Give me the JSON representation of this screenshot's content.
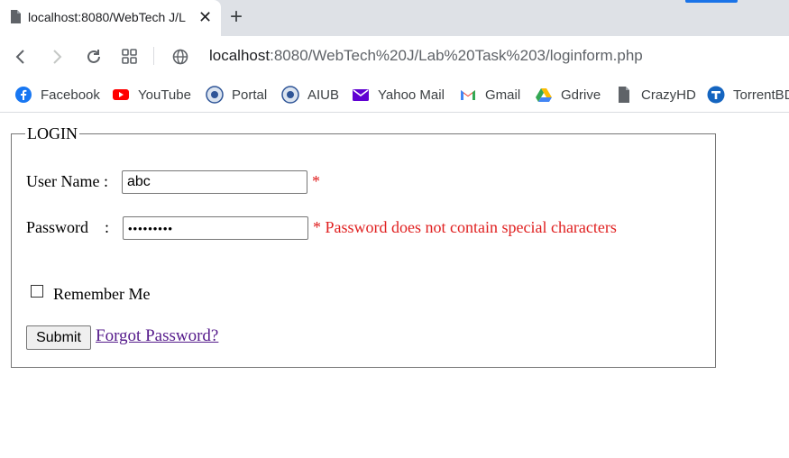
{
  "browser": {
    "tab_title": "localhost:8080/WebTech J/L",
    "url_host": "localhost",
    "url_rest": ":8080/WebTech%20J/Lab%20Task%203/loginform.php"
  },
  "bookmarks": [
    {
      "label": "Facebook",
      "icon": "facebook-icon",
      "color": "#1877f2"
    },
    {
      "label": "YouTube",
      "icon": "youtube-icon",
      "color": "#ff0000"
    },
    {
      "label": "Portal",
      "icon": "portal-icon",
      "color": "#2f5597"
    },
    {
      "label": "AIUB",
      "icon": "aiub-icon",
      "color": "#2f5597"
    },
    {
      "label": "Yahoo Mail",
      "icon": "yahoo-mail-icon",
      "color": "#6001d2"
    },
    {
      "label": "Gmail",
      "icon": "gmail-icon",
      "color": "#ea4335"
    },
    {
      "label": "Gdrive",
      "icon": "gdrive-icon",
      "color": "#34a853"
    },
    {
      "label": "CrazyHD",
      "icon": "file-icon",
      "color": "#5f6368"
    },
    {
      "label": "TorrentBD",
      "icon": "torrentbd-icon",
      "color": "#1565c0"
    }
  ],
  "form": {
    "legend": "LOGIN",
    "username_label": "User Name :",
    "username_value": "abc",
    "username_error": "*",
    "password_label": "Password    :",
    "password_value": "•••••••••",
    "password_error": "* Password does not contain special characters",
    "remember_label": "Remember Me",
    "remember_checked": false,
    "submit_label": "Submit",
    "forgot_link": "Forgot Password?"
  }
}
